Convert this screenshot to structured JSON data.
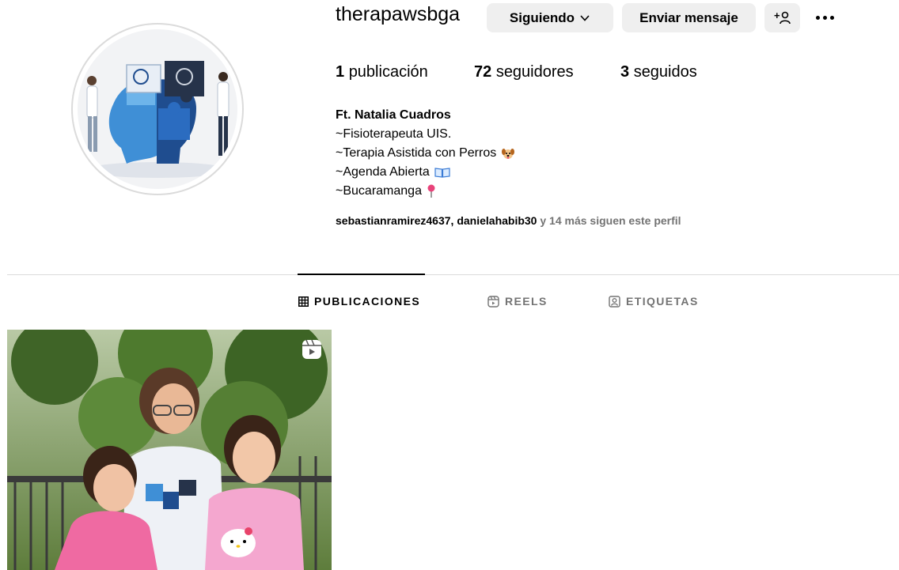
{
  "profile": {
    "username": "therapawsbga",
    "following_button": "Siguiendo",
    "message_button": "Enviar mensaje",
    "add_user_label": "+",
    "stats": {
      "posts_count": "1",
      "posts_label": "publicación",
      "followers_count": "72",
      "followers_label": "seguidores",
      "following_count": "3",
      "following_label": "seguidos"
    },
    "bio": {
      "name": "Ft. Natalia Cuadros",
      "lines": [
        "~Fisioterapeuta UIS.",
        "~Terapia Asistida con Perros",
        "~Agenda Abierta",
        "~Bucaramanga"
      ]
    },
    "followed_by": {
      "account1": "sebastianramirez4637",
      "separator": ", ",
      "account2": "danielahabib30",
      "rest": " y 14 más siguen este perfil"
    }
  },
  "tabs": [
    {
      "label": "PUBLICACIONES",
      "icon": "grid-icon",
      "active": true
    },
    {
      "label": "REELS",
      "icon": "reels-icon",
      "active": false
    },
    {
      "label": "ETIQUETAS",
      "icon": "tagged-icon",
      "active": false
    }
  ],
  "colors": {
    "button_bg": "#efefef",
    "muted_text": "#737373",
    "divider": "#dbdbdb",
    "logo_dark_blue": "#1f4d8f",
    "logo_light_blue": "#3f8fd6",
    "logo_navy": "#26334a"
  }
}
